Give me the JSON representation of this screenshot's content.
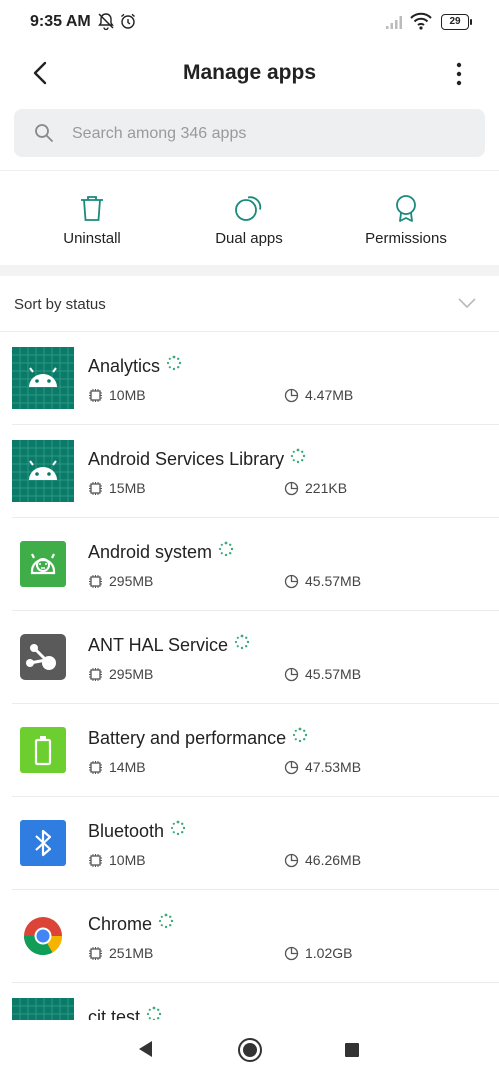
{
  "status_bar": {
    "time": "9:35 AM",
    "left_icons": [
      "muted-bell-icon",
      "alarm-icon"
    ],
    "right_icons": [
      "signal-icon",
      "wifi-icon",
      "battery-icon"
    ],
    "battery": "29"
  },
  "header": {
    "title": "Manage apps",
    "back_icon": "back-arrow-icon",
    "menu_icon": "more-vertical-icon"
  },
  "search": {
    "placeholder": "Search among 346 apps",
    "value": ""
  },
  "actions": [
    {
      "label": "Uninstall",
      "icon": "trash-icon"
    },
    {
      "label": "Dual apps",
      "icon": "dual-circles-icon"
    },
    {
      "label": "Permissions",
      "icon": "ribbon-icon"
    }
  ],
  "sort": {
    "label": "Sort by status",
    "icon": "chevron-down-icon"
  },
  "apps": [
    {
      "name": "Analytics",
      "app_size": "10MB",
      "data_size": "4.47MB",
      "icon": "android-grid-icon"
    },
    {
      "name": "Android Services Library",
      "app_size": "15MB",
      "data_size": "221KB",
      "icon": "android-grid-icon"
    },
    {
      "name": "Android system",
      "app_size": "295MB",
      "data_size": "45.57MB",
      "icon": "android-system-icon"
    },
    {
      "name": "ANT HAL Service",
      "app_size": "295MB",
      "data_size": "45.57MB",
      "icon": "ant-hal-icon"
    },
    {
      "name": "Battery and performance",
      "app_size": "14MB",
      "data_size": "47.53MB",
      "icon": "battery-app-icon"
    },
    {
      "name": "Bluetooth",
      "app_size": "10MB",
      "data_size": "46.26MB",
      "icon": "bluetooth-icon"
    },
    {
      "name": "Chrome",
      "app_size": "251MB",
      "data_size": "1.02GB",
      "icon": "chrome-icon"
    },
    {
      "name": "cit test",
      "app_size": "",
      "data_size": "",
      "icon": "android-grid-icon"
    }
  ],
  "nav": {
    "back": "nav-back-icon",
    "home": "nav-home-icon",
    "recents": "nav-recents-icon"
  },
  "colors": {
    "accent_teal": "#1a8a7a",
    "android_grid_bg": "#0b7a68",
    "android_system_green": "#3fae49",
    "battery_green": "#6ccf2f",
    "bluetooth_blue": "#2f7de1",
    "ant_gray": "#5a5a5a"
  }
}
